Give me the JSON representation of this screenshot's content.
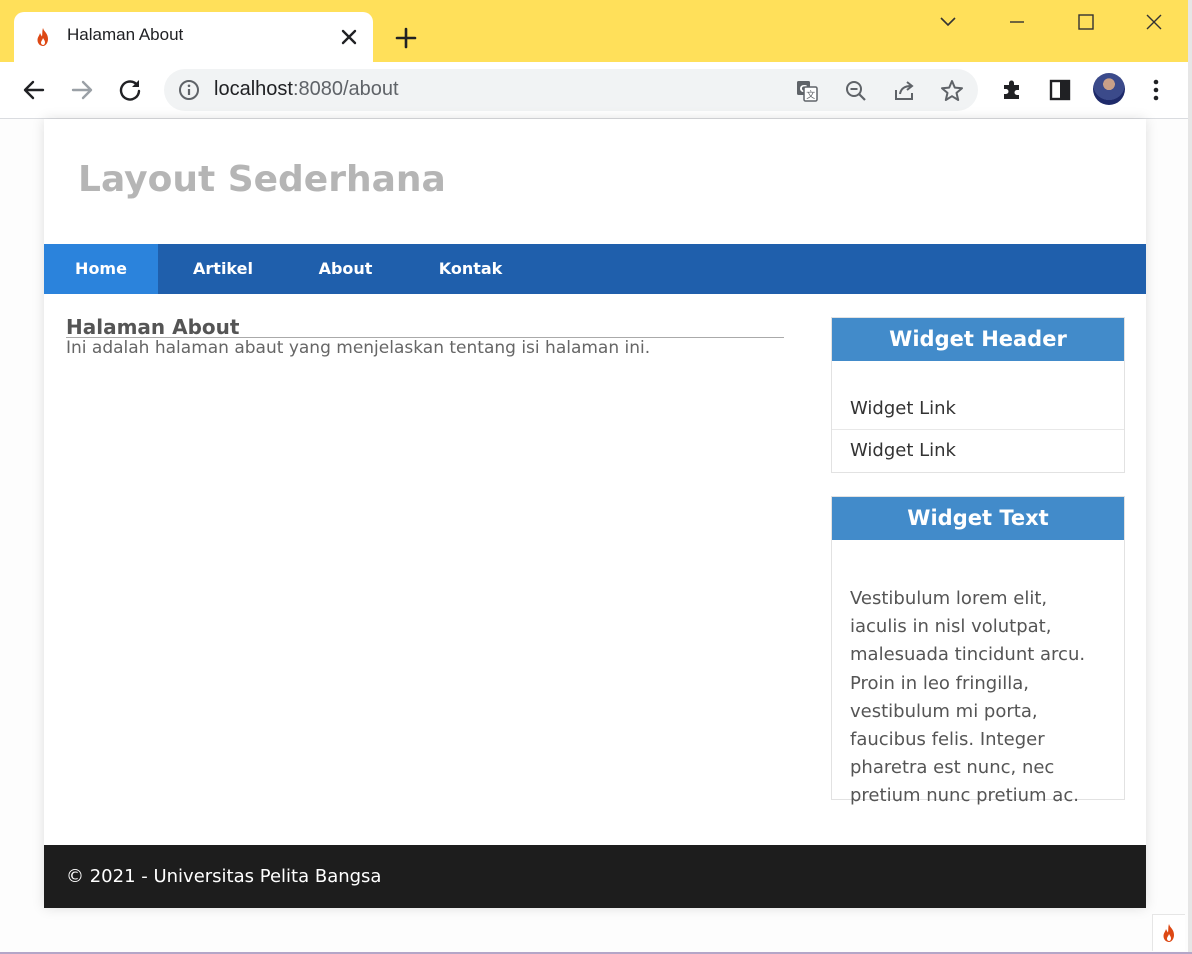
{
  "browser": {
    "tab_title": "Halaman About",
    "url_host": "localhost",
    "url_path": ":8080/about"
  },
  "site": {
    "title": "Layout Sederhana",
    "nav": [
      "Home",
      "Artikel",
      "About",
      "Kontak"
    ],
    "active_nav": "Home"
  },
  "main": {
    "heading": "Halaman About",
    "body": "Ini adalah halaman abaut yang menjelaskan tentang isi halaman ini."
  },
  "sidebar": {
    "widget1": {
      "header": "Widget Header",
      "links": [
        "Widget Link",
        "Widget Link"
      ]
    },
    "widget2": {
      "header": "Widget Text",
      "text": "Vestibulum lorem elit, iaculis in nisl volutpat, malesuada tincidunt arcu. Proin in leo fringilla, vestibulum mi porta, faucibus felis. Integer pharetra est nunc, nec pretium nunc pretium ac."
    }
  },
  "footer": {
    "text": "© 2021 - Universitas Pelita Bangsa"
  },
  "colors": {
    "titlebar": "#ffe05a",
    "nav": "#1f5fac",
    "nav_active": "#2b83dc",
    "widget_header": "#428bca",
    "footer": "#1d1d1d",
    "site_title": "#b5b5b5"
  },
  "icons": [
    "flame-icon",
    "close-icon",
    "plus-icon",
    "chevron-down-icon",
    "minimize-icon",
    "maximize-icon",
    "back-icon",
    "forward-icon",
    "reload-icon",
    "info-icon",
    "translate-icon",
    "zoom-out-icon",
    "share-icon",
    "star-icon",
    "extensions-icon",
    "side-panel-icon",
    "menu-icon"
  ]
}
